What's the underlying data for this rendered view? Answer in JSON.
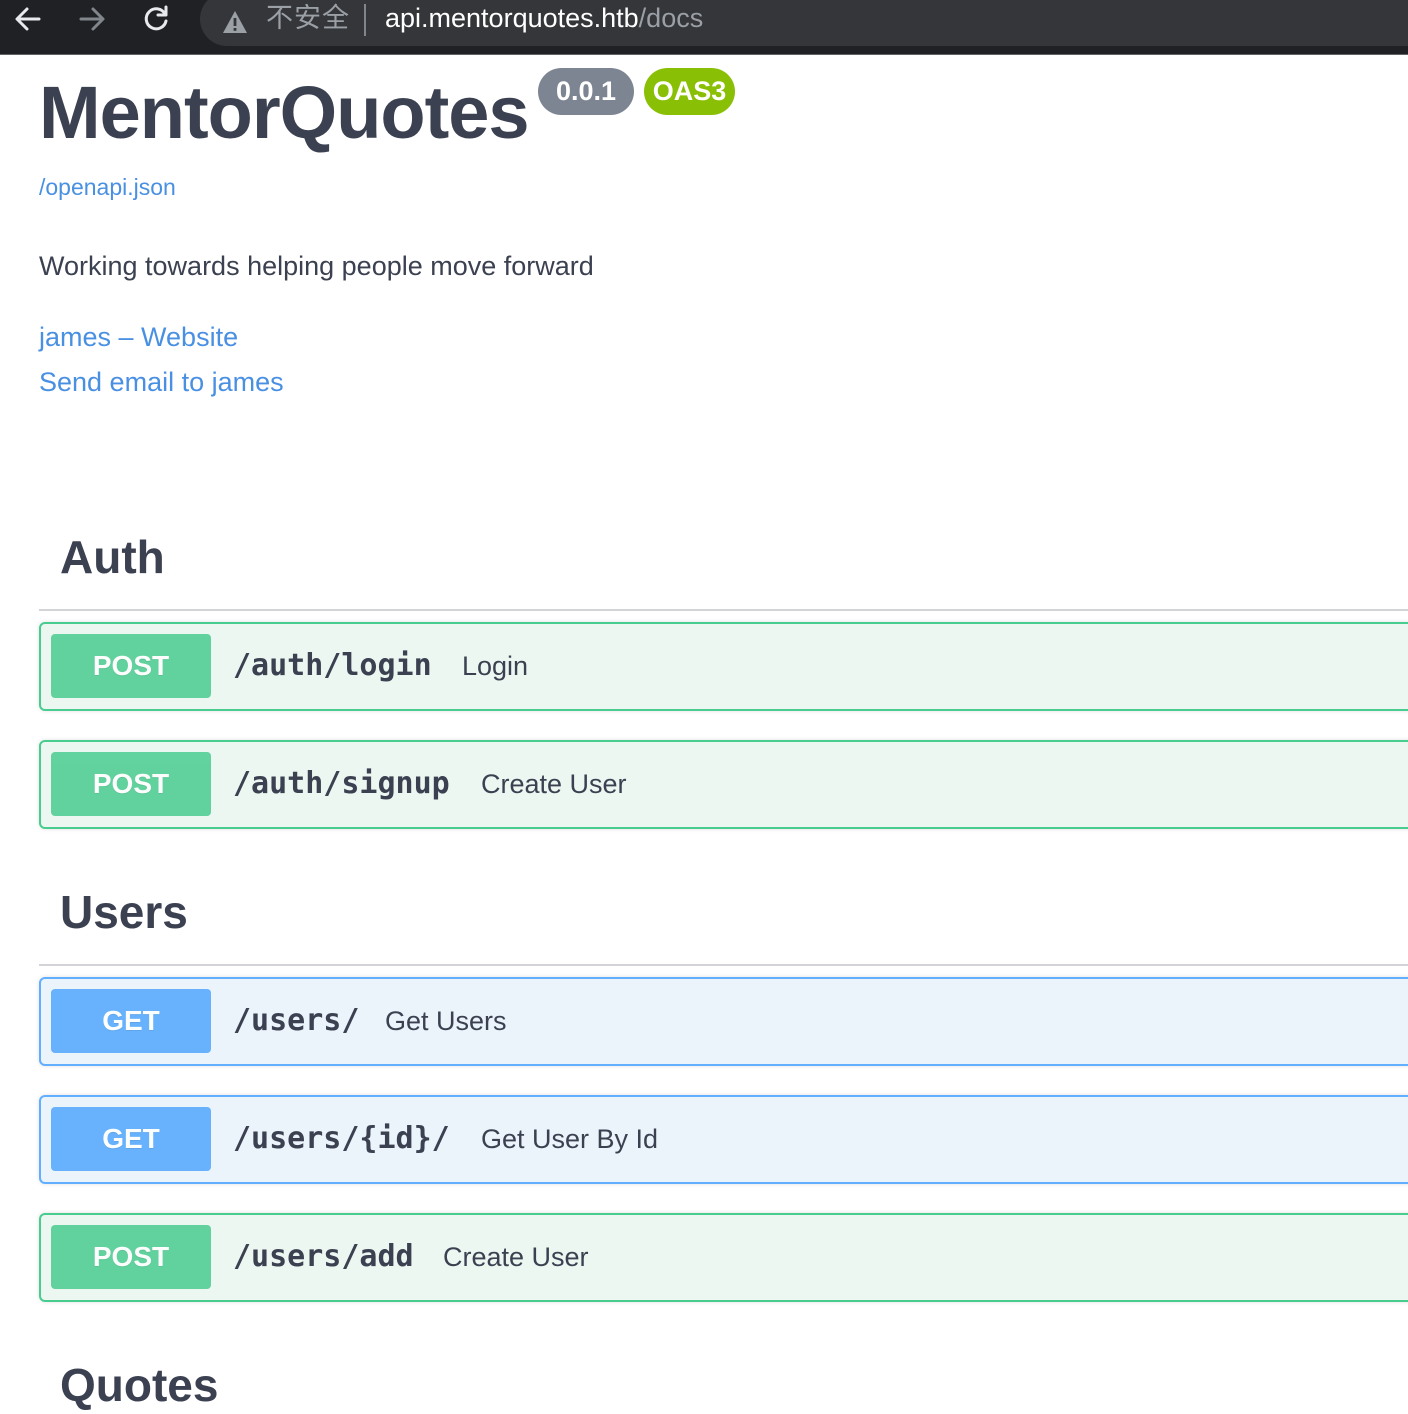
{
  "browser": {
    "security_label": "不安全",
    "url_host": "api.mentorquotes.htb",
    "url_path": "/docs"
  },
  "info": {
    "title": "MentorQuotes",
    "version": "0.0.1",
    "oas_badge": "OAS3",
    "spec_link": "/openapi.json",
    "description": "Working towards helping people move forward",
    "contact_website": "james – Website",
    "contact_email": "Send email to james"
  },
  "colors": {
    "post": "#49cc90",
    "get": "#61affe",
    "link": "#4990e2",
    "text": "#3b4151"
  },
  "sections": {
    "auth": {
      "title": "Auth",
      "ops": [
        {
          "method": "POST",
          "path": "/auth/login",
          "summary": "Login"
        },
        {
          "method": "POST",
          "path": "/auth/signup",
          "summary": "Create User"
        }
      ]
    },
    "users": {
      "title": "Users",
      "ops": [
        {
          "method": "GET",
          "path": "/users/",
          "summary": "Get Users"
        },
        {
          "method": "GET",
          "path": "/users/{id}/",
          "summary": "Get User By Id"
        },
        {
          "method": "POST",
          "path": "/users/add",
          "summary": "Create User"
        }
      ]
    },
    "quotes": {
      "title": "Quotes"
    }
  }
}
